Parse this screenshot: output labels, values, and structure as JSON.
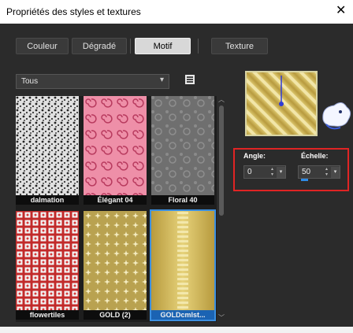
{
  "window": {
    "title": "Propriétés des styles et textures",
    "close_glyph": "✕"
  },
  "tabs": [
    {
      "label": "Couleur",
      "active": false
    },
    {
      "label": "Dégradé",
      "active": false
    },
    {
      "label": "Motif",
      "active": true
    },
    {
      "label": "Texture",
      "active": false
    }
  ],
  "category": {
    "value": "Tous",
    "arrow": "▾"
  },
  "icons": {
    "library": "book-icon",
    "close": "close-icon",
    "mascot": "mascot-icon"
  },
  "patterns": [
    {
      "label": "dalmation",
      "style": "dalmation"
    },
    {
      "label": "Élégant 04",
      "style": "elegant"
    },
    {
      "label": "Floral 40",
      "style": "floral"
    },
    {
      "label": "flowertiles",
      "style": "flowertiles"
    },
    {
      "label": "GOLD  (2)",
      "style": "gold2"
    },
    {
      "label": "GOLDcmlst...",
      "style": "goldcmlst",
      "selected": true
    }
  ],
  "scroll": {
    "up": "︿",
    "down": "﹀"
  },
  "params": {
    "angle_label": "Angle:",
    "angle_value": "0",
    "scale_label": "Échelle:",
    "scale_value": "50",
    "spin_up": "▴",
    "spin_down": "▾"
  },
  "colors": {
    "accent": "#2f8be6",
    "highlight": "#e02424",
    "background": "#2b2b2b"
  }
}
